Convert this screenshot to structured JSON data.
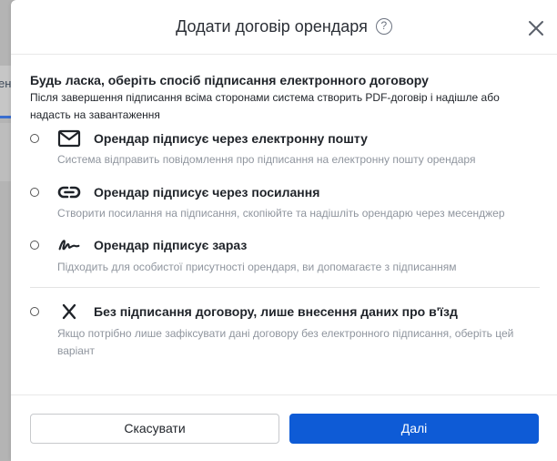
{
  "background": {
    "tab_fragment": "енд"
  },
  "dialog": {
    "title": "Додати договір орендаря",
    "help_glyph": "?",
    "close_glyph": "×"
  },
  "intro": {
    "heading": "Будь ласка, оберіть спосіб підписання електронного договору",
    "text": "Після завершення підписання всіма сторонами система створить PDF-договір і надішле або надасть на завантаження"
  },
  "options": [
    {
      "icon": "envelope-icon",
      "title": "Орендар підписує через електронну пошту",
      "description": "Система відправить повідомлення про підписання на електронну пошту орендаря"
    },
    {
      "icon": "link-icon",
      "title": "Орендар підписує через посилання",
      "description": "Створити посилання на підписання, скопіюйте та надішліть орендарю через месенджер"
    },
    {
      "icon": "signature-icon",
      "title": "Орендар підписує зараз",
      "description": "Підходить для особистої присутності орендаря, ви допомагаєте з підписанням"
    },
    {
      "icon": "x-icon",
      "title": "Без підписання договору, лише внесення даних про в'їзд",
      "description": "Якщо потрібно лише зафіксувати дані договору без електронного підписання, оберіть цей варіант"
    }
  ],
  "footer": {
    "cancel_label": "Скасувати",
    "next_label": "Далі"
  },
  "colors": {
    "primary": "#0e5bd6",
    "muted_text": "#8f959e",
    "overlay": "#a9a9a9"
  }
}
